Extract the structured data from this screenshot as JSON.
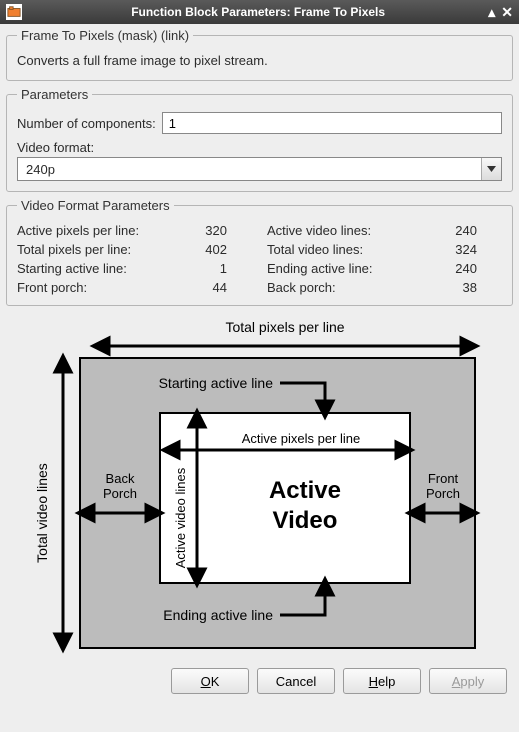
{
  "title": "Function Block Parameters: Frame To Pixels",
  "mask": {
    "legend": "Frame To Pixels (mask) (link)",
    "description": "Converts a full frame image to pixel stream."
  },
  "parameters": {
    "legend": "Parameters",
    "num_components_label": "Number of components:",
    "num_components_value": "1",
    "video_format_label": "Video format:",
    "video_format_value": "240p"
  },
  "vfp": {
    "legend": "Video Format Parameters",
    "active_pixels_label": "Active pixels per line:",
    "active_pixels_value": "320",
    "total_pixels_label": "Total pixels per line:",
    "total_pixels_value": "402",
    "starting_active_label": "Starting active line:",
    "starting_active_value": "1",
    "front_porch_label": "Front porch:",
    "front_porch_value": "44",
    "active_lines_label": "Active video lines:",
    "active_lines_value": "240",
    "total_lines_label": "Total video lines:",
    "total_lines_value": "324",
    "ending_active_label": "Ending active line:",
    "ending_active_value": "240",
    "back_porch_label": "Back porch:",
    "back_porch_value": "38"
  },
  "diagram": {
    "total_pixels": "Total pixels per line",
    "total_lines": "Total video lines",
    "starting_active": "Starting active line",
    "ending_active": "Ending active line",
    "active_pixels": "Active pixels per line",
    "active_lines": "Active video lines",
    "back_porch": "Back\nPorch",
    "front_porch": "Front\nPorch",
    "active_video_l1": "Active",
    "active_video_l2": "Video"
  },
  "buttons": {
    "ok": "K",
    "ok_pre": "O",
    "cancel": "Cancel",
    "help": "elp",
    "help_pre": "H",
    "apply": "pply",
    "apply_pre": "A"
  }
}
